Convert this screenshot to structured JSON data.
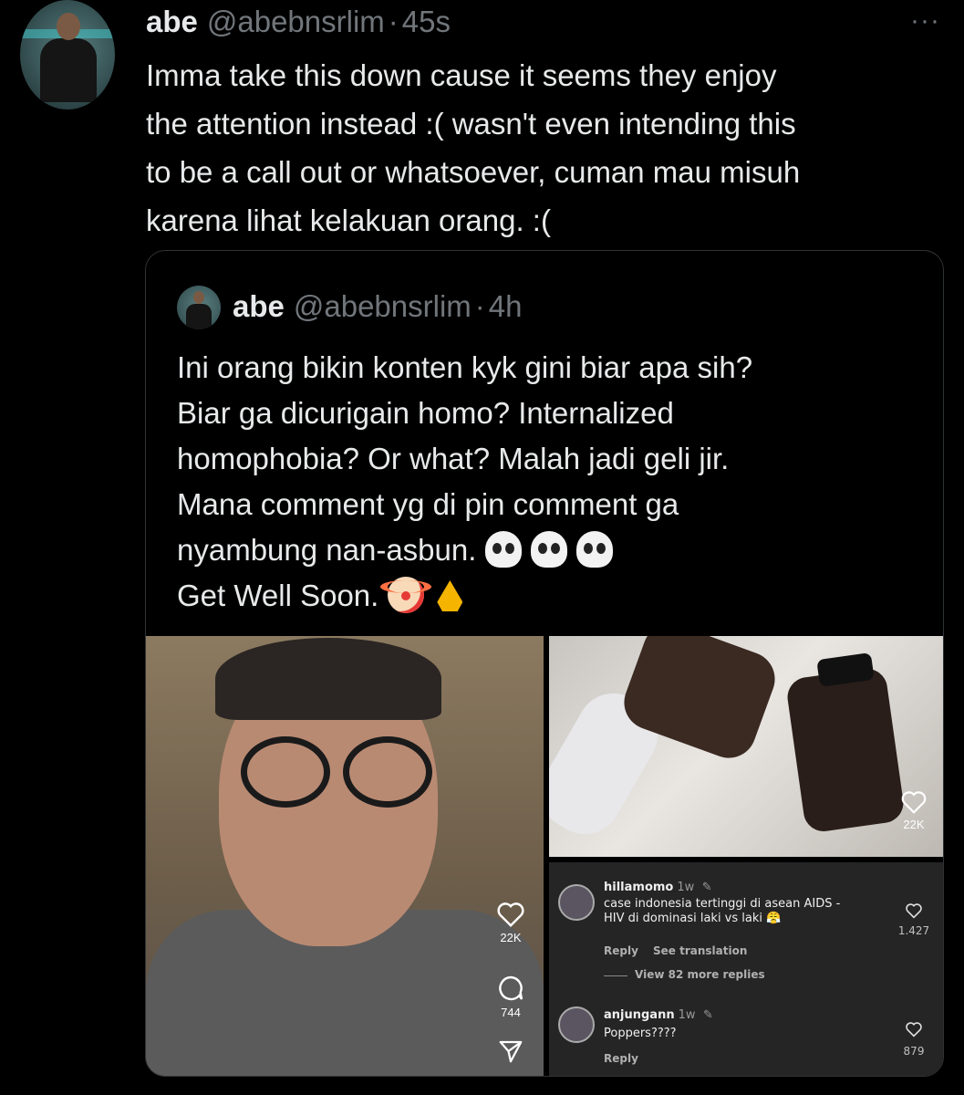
{
  "tweet": {
    "name": "abe",
    "handle": "@abebnsrlim",
    "separator": "·",
    "time": "45s",
    "more_label": "···",
    "text": "Imma take this down cause it seems they enjoy\nthe attention instead :( wasn't even intending this\nto be a call out or whatsoever, cuman mau misuh\nkarena lihat kelakuan orang. :("
  },
  "quoted": {
    "name": "abe",
    "handle": "@abebnsrlim",
    "separator": "·",
    "time": "4h",
    "text_lines": [
      "Ini orang bikin konten kyk gini biar apa sih?",
      "Biar ga dicurigain homo? Internalized",
      "homophobia? Or what? Malah jadi geli jir.",
      "Mana comment yg di pin comment ga",
      "nyambung nan-asbun.",
      "Get Well Soon."
    ],
    "emojis": {
      "line5": [
        "skull",
        "skull",
        "skull"
      ],
      "line6": [
        "clown-face",
        "folded-hands"
      ]
    },
    "media_left": {
      "like_count": "22K",
      "comment_count": "744"
    },
    "media_right": {
      "like_count": "22K"
    },
    "comments": [
      {
        "user": "hillamomo",
        "age": "1w",
        "text": "case indonesia tertinggi di asean AIDS -\nHIV di dominasi laki vs laki 😤",
        "reply": "Reply",
        "see_translation": "See translation",
        "likes": "1.427"
      },
      {
        "view_more": "View 82 more replies"
      },
      {
        "user": "anjungann",
        "age": "1w",
        "text": "Poppers????",
        "reply": "Reply",
        "likes": "879"
      }
    ]
  }
}
